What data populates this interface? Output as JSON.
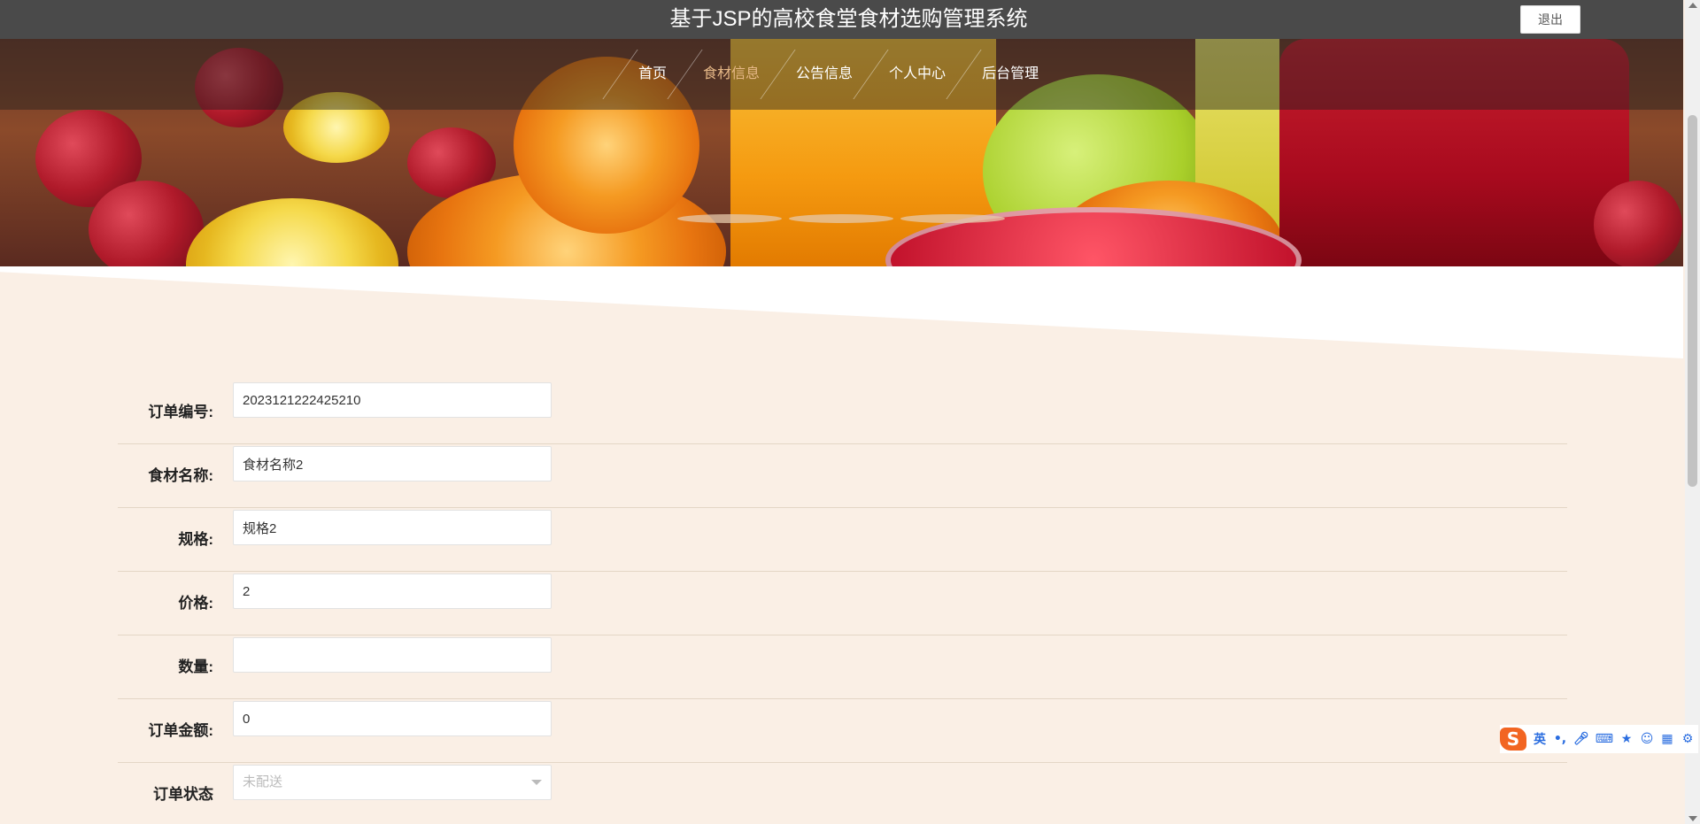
{
  "header": {
    "title": "基于JSP的高校食堂食材选购管理系统",
    "logout_label": "退出"
  },
  "nav": {
    "items": [
      {
        "label": "首页",
        "active": false
      },
      {
        "label": "食材信息",
        "active": true
      },
      {
        "label": "公告信息",
        "active": false
      },
      {
        "label": "个人中心",
        "active": false
      },
      {
        "label": "后台管理",
        "active": false
      }
    ]
  },
  "carousel": {
    "slide_count": 3
  },
  "form": {
    "order_no": {
      "label": "订单编号:",
      "value": "2023121222425210"
    },
    "food_name": {
      "label": "食材名称:",
      "value": "食材名称2"
    },
    "spec": {
      "label": "规格:",
      "value": "规格2"
    },
    "price": {
      "label": "价格:",
      "value": "2"
    },
    "quantity": {
      "label": "数量:",
      "value": ""
    },
    "amount": {
      "label": "订单金额:",
      "value": "0"
    },
    "status": {
      "label": "订单状态",
      "selected": "未配送"
    }
  },
  "ime": {
    "logo": "S",
    "lang": "英",
    "punct": "•,",
    "icons": [
      "mic-icon",
      "keyboard-icon",
      "skin-icon",
      "emoji-icon",
      "grid-icon",
      "settings-icon"
    ]
  },
  "colors": {
    "topbar": "#4a4a4a",
    "page_bg": "#faefe5",
    "nav_active": "#e6b887",
    "ime_accent": "#f26522"
  }
}
